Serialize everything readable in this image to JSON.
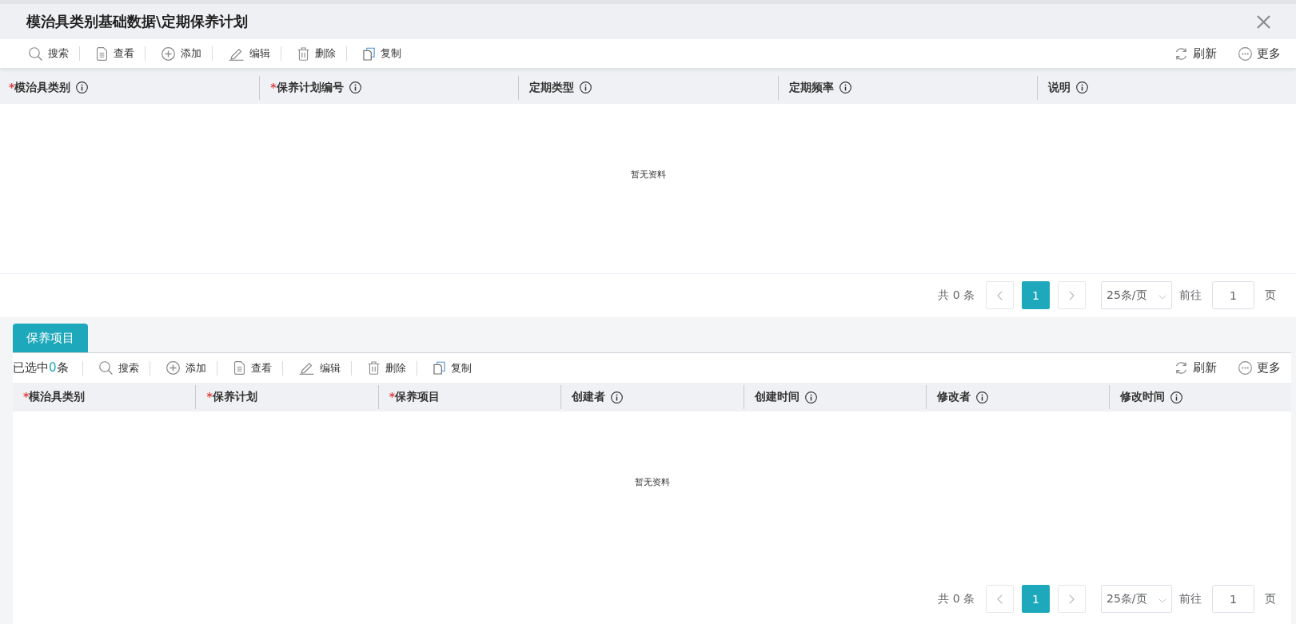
{
  "window": {
    "title": "模治具类别基础数据\\定期保养计划"
  },
  "toolbar": {
    "left": [
      {
        "kind": "search",
        "label": "搜索"
      },
      {
        "kind": "view",
        "label": "查看"
      },
      {
        "kind": "add",
        "label": "添加"
      },
      {
        "kind": "edit",
        "label": "编辑"
      },
      {
        "kind": "delete",
        "label": "删除"
      },
      {
        "kind": "copy",
        "label": "复制"
      }
    ],
    "right": [
      {
        "kind": "refresh",
        "label": "刷新"
      },
      {
        "kind": "more",
        "label": "更多"
      }
    ]
  },
  "table": {
    "columns": [
      {
        "label": "模治具类别",
        "required_mark": "*",
        "info": true
      },
      {
        "label": "保养计划编号",
        "required_mark": "*",
        "info": true
      },
      {
        "label": "定期类型",
        "info": true
      },
      {
        "label": "定期频率",
        "info": true
      },
      {
        "label": "说明",
        "info": true
      }
    ],
    "empty_text": "暂无资料"
  },
  "pagination": {
    "total": "共 0 条",
    "pages": [
      {
        "label": "1",
        "selected": true
      }
    ],
    "page_size": "25条/页",
    "goto_label": "前往",
    "goto_value": "1",
    "goto_suffix": "页"
  },
  "detail_tabs": [
    {
      "label": "保养项目",
      "selected": true
    }
  ],
  "detail": {
    "selection": {
      "prefix": "已选中",
      "count": "0",
      "suffix": "条"
    },
    "toolbar": {
      "left": [
        {
          "kind": "search",
          "label": "搜索"
        },
        {
          "kind": "add",
          "label": "添加"
        },
        {
          "kind": "view",
          "label": "查看"
        },
        {
          "kind": "edit",
          "label": "编辑"
        },
        {
          "kind": "delete",
          "label": "删除"
        },
        {
          "kind": "copy",
          "label": "复制"
        }
      ],
      "right": [
        {
          "kind": "refresh",
          "label": "刷新"
        },
        {
          "kind": "more",
          "label": "更多"
        }
      ]
    },
    "table": {
      "columns": [
        {
          "label": "模治具类别",
          "required_mark": "*",
          "info": false
        },
        {
          "label": "保养计划",
          "required_mark": "*",
          "info": false
        },
        {
          "label": "保养项目",
          "required_mark": "*",
          "info": false
        },
        {
          "label": "创建者",
          "info": true
        },
        {
          "label": "创建时间",
          "info": true
        },
        {
          "label": "修改者",
          "info": true
        },
        {
          "label": "修改时间",
          "info": true
        }
      ],
      "empty_text": "暂无资料"
    },
    "pagination": {
      "total": "共 0 条",
      "pages": [
        {
          "label": "1",
          "selected": true
        }
      ],
      "page_size": "25条/页",
      "goto_label": "前往",
      "goto_value": "1",
      "goto_suffix": "页"
    }
  }
}
